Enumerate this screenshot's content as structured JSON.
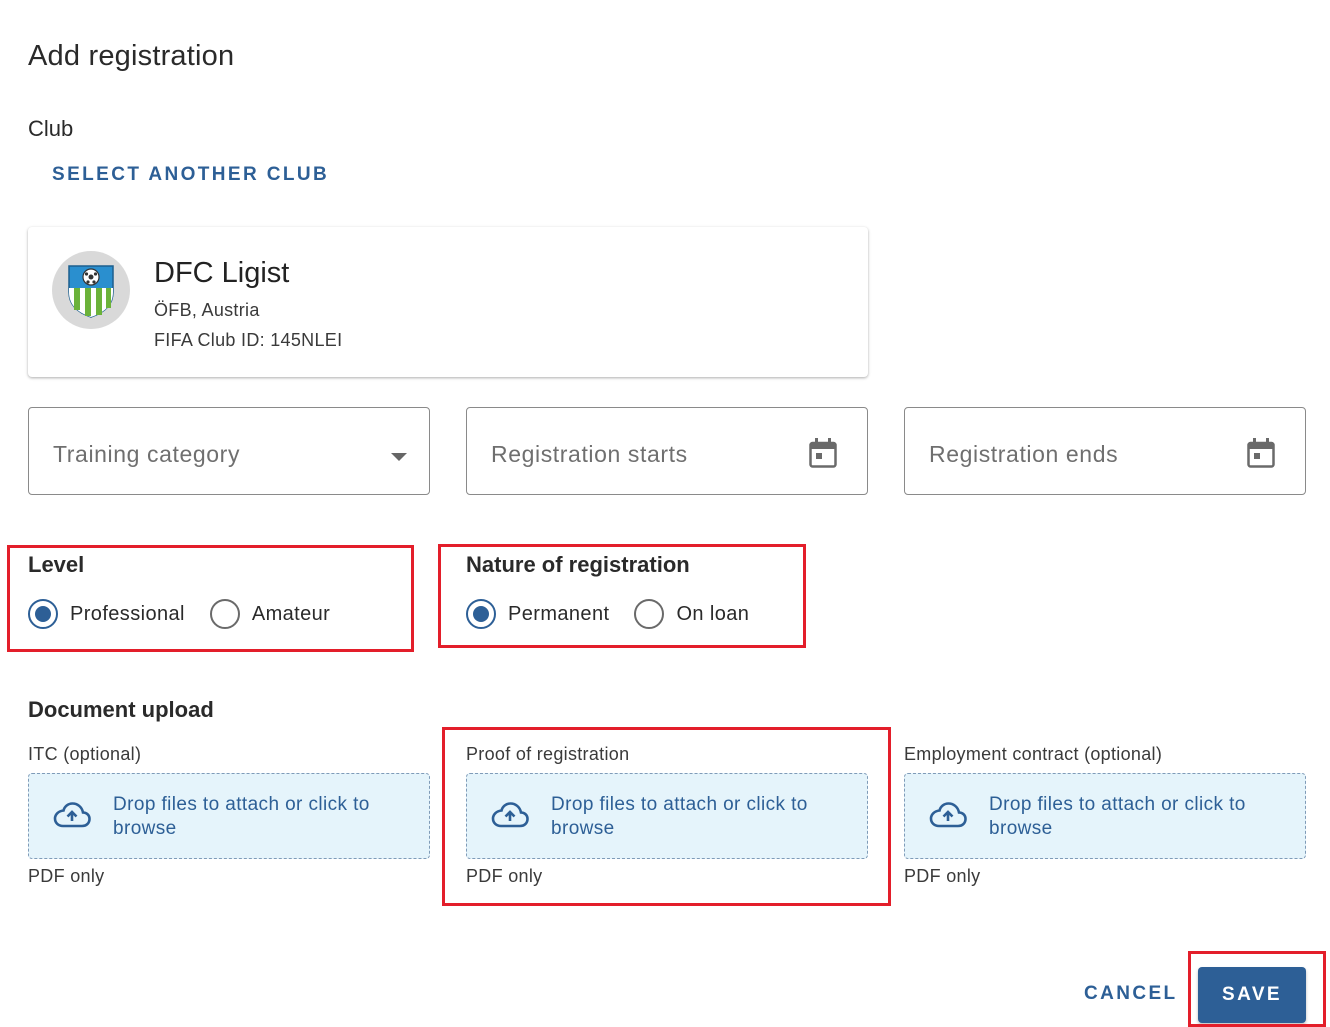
{
  "dialog": {
    "title": "Add registration"
  },
  "club": {
    "section_label": "Club",
    "select_another_label": "SELECT ANOTHER CLUB",
    "name": "DFC Ligist",
    "association": "ÖFB, Austria",
    "fifa_id": "FIFA Club ID: 145NLEI",
    "logo_icon": "club-crest-icon"
  },
  "fields": {
    "training_category": {
      "placeholder": "Training category",
      "icon": "dropdown-arrow-icon"
    },
    "registration_starts": {
      "placeholder": "Registration starts",
      "icon": "calendar-icon"
    },
    "registration_ends": {
      "placeholder": "Registration ends",
      "icon": "calendar-icon"
    }
  },
  "level": {
    "label": "Level",
    "options": [
      {
        "label": "Professional",
        "checked": true
      },
      {
        "label": "Amateur",
        "checked": false
      }
    ]
  },
  "nature": {
    "label": "Nature of registration",
    "options": [
      {
        "label": "Permanent",
        "checked": true
      },
      {
        "label": "On loan",
        "checked": false
      }
    ]
  },
  "documents": {
    "section_label": "Document upload",
    "uploads": [
      {
        "title": "ITC (optional)",
        "drop_text": "Drop files to attach or click to browse",
        "hint": "PDF only"
      },
      {
        "title": "Proof of registration",
        "drop_text": "Drop files to attach or click to browse",
        "hint": "PDF only"
      },
      {
        "title": "Employment contract (optional)",
        "drop_text": "Drop files to attach or click to browse",
        "hint": "PDF only"
      }
    ]
  },
  "actions": {
    "cancel_label": "CANCEL",
    "save_label": "SAVE"
  },
  "colors": {
    "primary": "#2d5f96",
    "highlight": "#e31e2a",
    "dropzone_bg": "#e5f4fb"
  }
}
